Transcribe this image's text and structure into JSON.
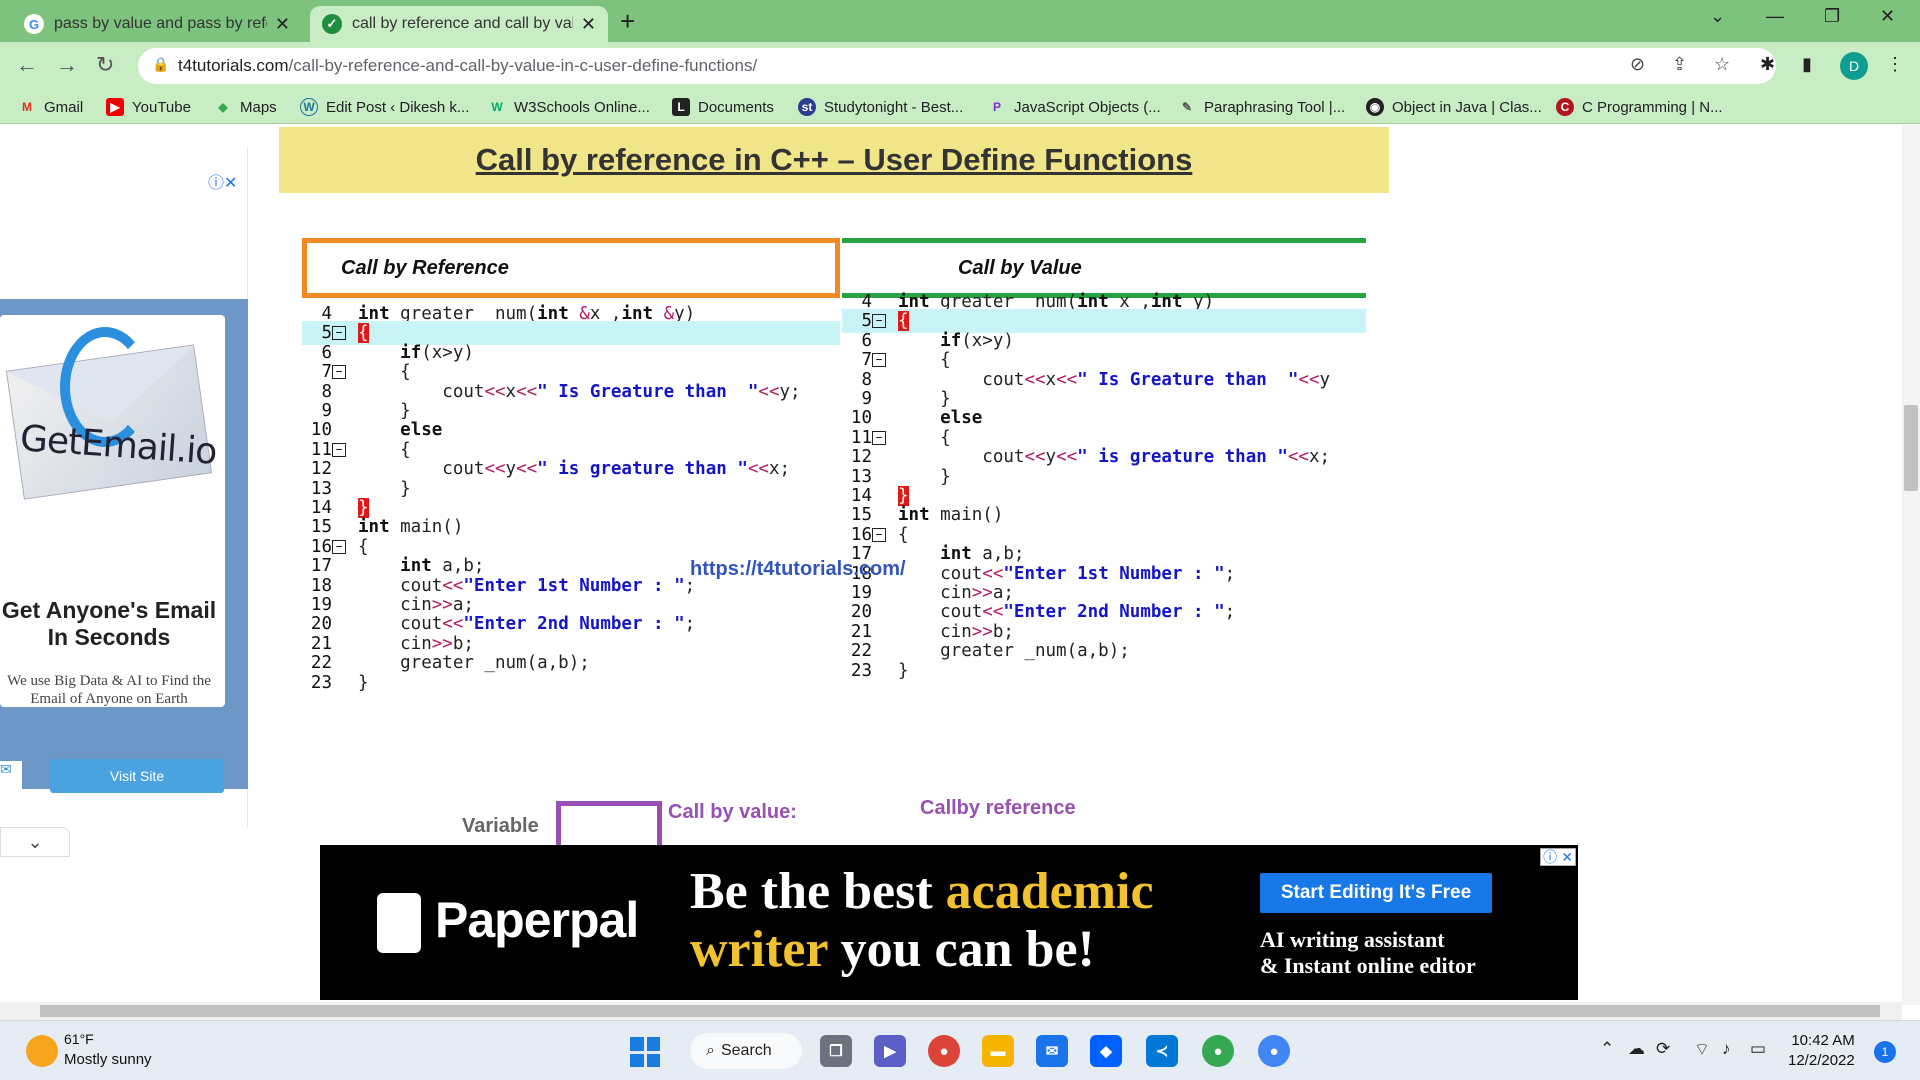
{
  "browser": {
    "tabs": [
      {
        "title": "pass by value and pass by refere",
        "active": false
      },
      {
        "title": "call by reference and call by valu",
        "active": true
      }
    ],
    "url_domain": "t4tutorials.com",
    "url_path": "/call-by-reference-and-call-by-value-in-c-user-define-functions/",
    "profile_initial": "D",
    "bookmarks": [
      {
        "label": "Gmail",
        "icon": "gmail-icon"
      },
      {
        "label": "YouTube",
        "icon": "youtube-icon"
      },
      {
        "label": "Maps",
        "icon": "maps-icon"
      },
      {
        "label": "Edit Post ‹ Dikesh k...",
        "icon": "wordpress-icon"
      },
      {
        "label": "W3Schools Online...",
        "icon": "w3schools-icon"
      },
      {
        "label": "Documents",
        "icon": "documents-icon"
      },
      {
        "label": "Studytonight - Best...",
        "icon": "studytonight-icon"
      },
      {
        "label": "JavaScript Objects (...",
        "icon": "javascript-icon"
      },
      {
        "label": "Paraphrasing Tool |...",
        "icon": "quill-icon"
      },
      {
        "label": "Object in Java | Clas...",
        "icon": "globe-icon"
      },
      {
        "label": "C Programming | N...",
        "icon": "c-icon"
      }
    ]
  },
  "page": {
    "heading": "Call by reference in C++ – User Define Functions",
    "left_ad": {
      "brand": "GetEmail.io",
      "headline": "Get Anyone's Email In Seconds",
      "subtext": "We use Big Data & AI to Find the Email of Anyone on Earth",
      "button": "Visit Site"
    },
    "panel_ref_title": "Call by Reference",
    "panel_val_title": "Call by Value",
    "watermark": "https://t4tutorials.com/",
    "variable_label": "Variable",
    "call_by_value_label": "Call by value:",
    "call_by_reference_label": "Callby reference",
    "ref_code": [
      {
        "n": "4",
        "t": "int greater _num(int &x ,int &y)"
      },
      {
        "n": "5",
        "t": "{"
      },
      {
        "n": "6",
        "t": "    if(x>y)"
      },
      {
        "n": "7",
        "t": "    {"
      },
      {
        "n": "8",
        "t": "        cout<<x<<\" Is Greature than  \"<<y;"
      },
      {
        "n": "9",
        "t": "    }"
      },
      {
        "n": "10",
        "t": "    else"
      },
      {
        "n": "11",
        "t": "    {"
      },
      {
        "n": "12",
        "t": "        cout<<y<<\" is greature than \"<<x;"
      },
      {
        "n": "13",
        "t": "    }"
      },
      {
        "n": "14",
        "t": "}"
      },
      {
        "n": "15",
        "t": "int main()"
      },
      {
        "n": "16",
        "t": "{"
      },
      {
        "n": "17",
        "t": "    int a,b;"
      },
      {
        "n": "18",
        "t": "    cout<<\"Enter 1st Number : \";"
      },
      {
        "n": "19",
        "t": "    cin>>a;"
      },
      {
        "n": "20",
        "t": "    cout<<\"Enter 2nd Number : \";"
      },
      {
        "n": "21",
        "t": "    cin>>b;"
      },
      {
        "n": "22",
        "t": "    greater _num(a,b);"
      },
      {
        "n": "23",
        "t": "}"
      }
    ],
    "val_code": [
      {
        "n": "4",
        "t": "int greater _num(int x ,int y)"
      },
      {
        "n": "5",
        "t": "{"
      },
      {
        "n": "6",
        "t": "    if(x>y)"
      },
      {
        "n": "7",
        "t": "    {"
      },
      {
        "n": "8",
        "t": "        cout<<x<<\" Is Greature than  \"<<y"
      },
      {
        "n": "9",
        "t": "    }"
      },
      {
        "n": "10",
        "t": "    else"
      },
      {
        "n": "11",
        "t": "    {"
      },
      {
        "n": "12",
        "t": "        cout<<y<<\" is greature than \"<<x;"
      },
      {
        "n": "13",
        "t": "    }"
      },
      {
        "n": "14",
        "t": "}"
      },
      {
        "n": "15",
        "t": "int main()"
      },
      {
        "n": "16",
        "t": "{"
      },
      {
        "n": "17",
        "t": "    int a,b;"
      },
      {
        "n": "18",
        "t": "    cout<<\"Enter 1st Number : \";"
      },
      {
        "n": "19",
        "t": "    cin>>a;"
      },
      {
        "n": "20",
        "t": "    cout<<\"Enter 2nd Number : \";"
      },
      {
        "n": "21",
        "t": "    cin>>b;"
      },
      {
        "n": "22",
        "t": "    greater _num(a,b);"
      },
      {
        "n": "23",
        "t": "}"
      }
    ]
  },
  "bottom_ad": {
    "brand": "Paperpal",
    "slogan_1a": "Be the best ",
    "slogan_1b": "academic",
    "slogan_2a": "writer",
    "slogan_2b": " you can be!",
    "button": "Start Editing It's Free",
    "sub_1": "AI writing assistant",
    "sub_2": "& Instant online editor"
  },
  "taskbar": {
    "temperature": "61°F",
    "condition": "Mostly sunny",
    "search": "Search",
    "time": "10:42 AM",
    "date": "12/2/2022",
    "notifications": "1"
  },
  "colors": {
    "tab_strip": "#7dc27d",
    "toolbar": "#c8ecc3",
    "title_bg": "#f1e58a",
    "ref_border": "#f08a24",
    "val_border": "#25a244",
    "code_string": "#1515c8",
    "label_purple": "#9a4fb3",
    "ad_yellow": "#f2c12e"
  }
}
